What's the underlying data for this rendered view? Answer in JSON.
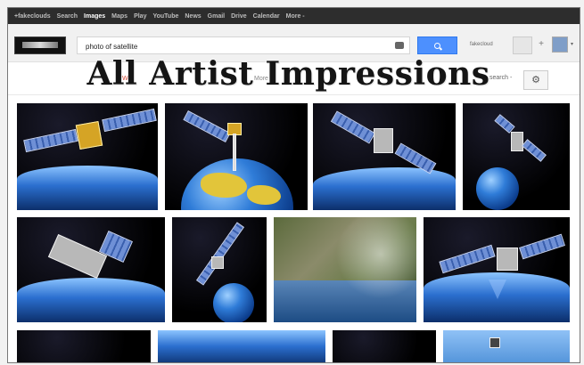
{
  "topnav": {
    "items": [
      "+fakeclouds",
      "Search",
      "Images",
      "Maps",
      "Play",
      "YouTube",
      "News",
      "Gmail",
      "Drive",
      "Calendar",
      "More -"
    ],
    "active_index": 2
  },
  "search": {
    "value": "photo of satellite"
  },
  "header": {
    "user": "fakecloud",
    "plus": "+"
  },
  "subnav": {
    "web": "Web",
    "more": "More",
    "safe": "search -"
  },
  "overlay_title": "All Artist Impressions",
  "icons": {
    "settings": "gear-icon",
    "search": "search-icon",
    "camera": "camera-icon",
    "avatar": "avatar"
  },
  "colors": {
    "topbar": "#2d2d2d",
    "search_button": "#4d90fe",
    "overlay_text": "#151515"
  }
}
